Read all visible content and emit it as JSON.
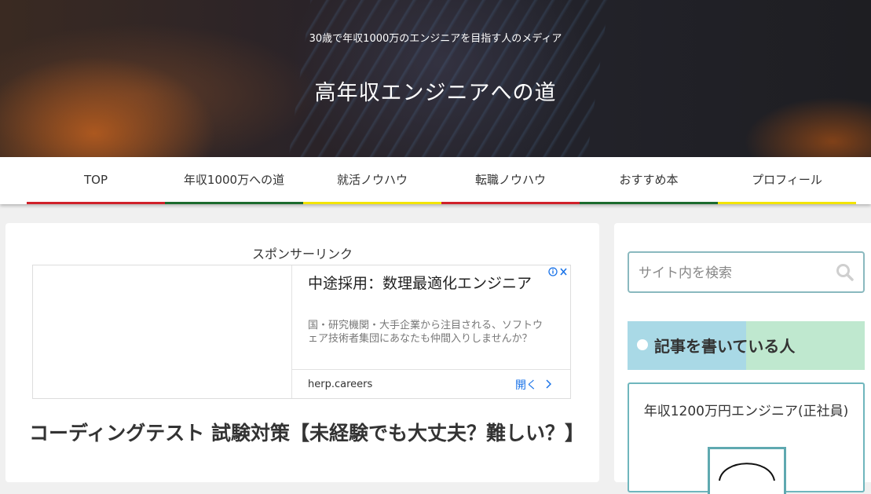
{
  "header": {
    "tagline": "30歳で年収1000万のエンジニアを目指す人のメディア",
    "site_title": "高年収エンジニアへの道"
  },
  "nav": {
    "items": [
      {
        "label": "TOP",
        "color": "#d0212a"
      },
      {
        "label": "年収1000万への道",
        "color": "#1c6b2e"
      },
      {
        "label": "就活ノウハウ",
        "color": "#f2e400"
      },
      {
        "label": "転職ノウハウ",
        "color": "#d0212a"
      },
      {
        "label": "おすすめ本",
        "color": "#1c6b2e"
      },
      {
        "label": "プロフィール",
        "color": "#f2e400"
      }
    ]
  },
  "main": {
    "sponsor_label": "スポンサーリンク",
    "ad": {
      "headline": "中途採用：数理最適化エンジニア",
      "description": "国・研究機関・大手企業から注目される、ソフトウェア技術者集団にあなたも仲間入りしませんか？",
      "domain": "herp.careers",
      "open_label": "開く",
      "choices_icon": "adchoices-icon"
    },
    "post_title": "コーディングテスト 試験対策【未経験でも大丈夫？難しい？】"
  },
  "sidebar": {
    "search": {
      "placeholder": "サイト内を検索",
      "icon": "search-icon"
    },
    "author_widget": {
      "heading": "記事を書いている人",
      "profile_name": "年収1200万円エンジニア(正社員)"
    }
  },
  "colors": {
    "accent_teal": "#6fb6bd",
    "nav_red": "#d0212a",
    "nav_green": "#1c6b2e",
    "nav_yellow": "#f2e400",
    "link_blue": "#1a73e8"
  }
}
